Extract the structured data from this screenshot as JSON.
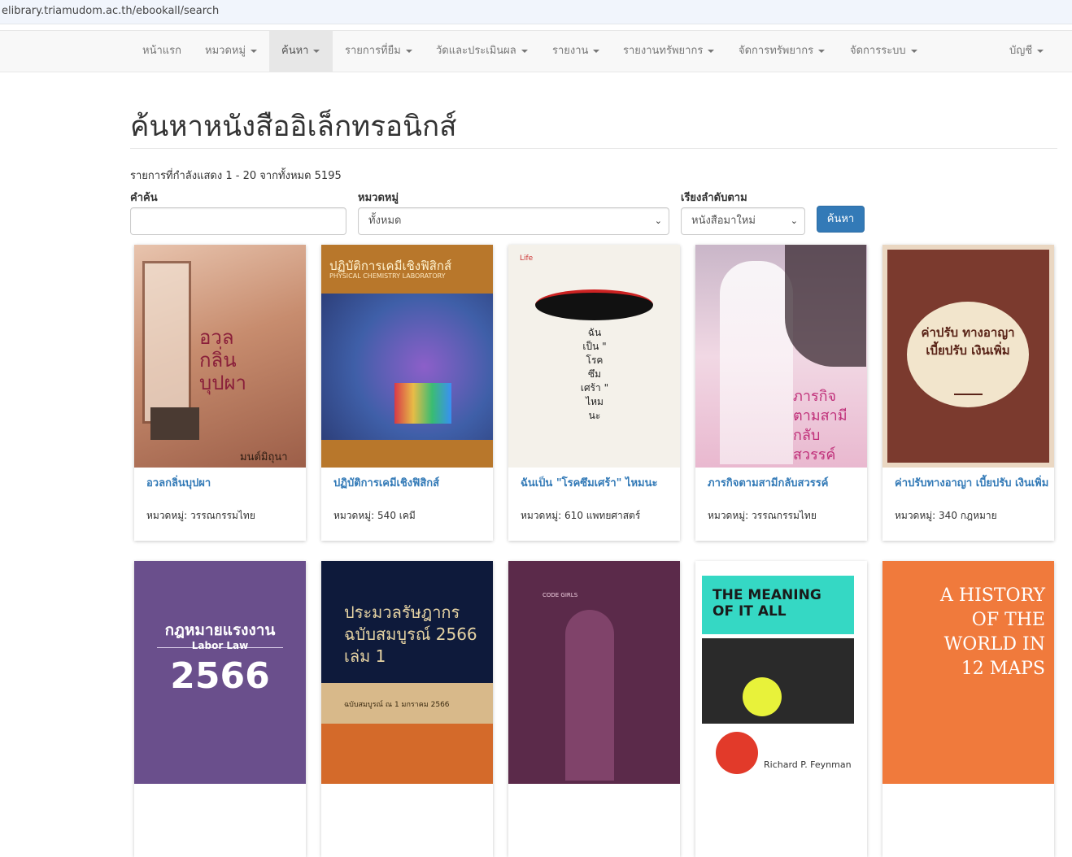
{
  "browser": {
    "url": "elibrary.triamudom.ac.th/ebookall/search"
  },
  "nav": {
    "items": [
      {
        "label": "หน้าแรก"
      },
      {
        "label": "หมวดหมู่"
      },
      {
        "label": "ค้นหา"
      },
      {
        "label": "รายการที่ยืม"
      },
      {
        "label": "วัดและประเมินผล"
      },
      {
        "label": "รายงาน"
      },
      {
        "label": "รายงานทรัพยากร"
      },
      {
        "label": "จัดการทรัพยากร"
      },
      {
        "label": "จัดการระบบ"
      }
    ],
    "account": "บัญชี"
  },
  "page": {
    "title": "ค้นหาหนังสืออิเล็กทรอนิกส์",
    "showing": "รายการที่กำลังแสดง 1 - 20 จากทั้งหมด 5195"
  },
  "filters": {
    "keyword_label": "คำค้น",
    "keyword_value": "",
    "category_label": "หมวดหมู่",
    "category_value": "ทั้งหมด",
    "sort_label": "เรียงลำดับตาม",
    "sort_value": "หนังสือมาใหม่",
    "search_button": "ค้นหา"
  },
  "category_prefix": "หมวดหมู่:",
  "books": [
    {
      "title": "อวลกลิ่นบุปผา",
      "category": "วรรณกรรมไทย",
      "cover": {
        "bg": "#c79a82",
        "text": "อวล กลิ่น บุปผา",
        "sub": "มนต์มิถุนา",
        "fg": "#8a1f3a"
      }
    },
    {
      "title": "ปฏิบัติการเคมีเชิงฟิสิกส์",
      "category": "540 เคมี",
      "cover": {
        "bg": "#b8772b",
        "text": "ปฏิบัติการเคมีเชิงฟิสิกส์",
        "sub": "PHYSICAL CHEMISTRY LABORATORY",
        "fg": "#fff3d0"
      }
    },
    {
      "title": "ฉันเป็น \"โรคซึมเศร้า\" ไหมนะ",
      "category": "610 แพทยศาสตร์",
      "cover": {
        "bg": "#f4f1ea",
        "text": "ฉัน เป็น \" โรค ซึม เศร้า \" ไหม นะ",
        "sub": "Life",
        "fg": "#222"
      }
    },
    {
      "title": "ภารกิจตามสามีกลับสวรรค์",
      "category": "วรรณกรรมไทย",
      "cover": {
        "bg": "#e9c9d8",
        "text": "ภารกิจ ตามสามี กลับสวรรค์",
        "sub": "",
        "fg": "#c0307a"
      }
    },
    {
      "title": "ค่าปรับทางอาญา เบี้ยปรับ เงินเพิ่ม",
      "category": "340 กฎหมาย",
      "cover": {
        "bg": "#7b3a2e",
        "text": "ค่าปรับ ทางอาญา เบี้ยปรับ เงินเพิ่ม",
        "sub": "",
        "fg": "#5a2418"
      }
    },
    {
      "title": "",
      "category": "",
      "cover": {
        "bg": "#6a4f8c",
        "text": "กฎหมายแรงงาน",
        "sub": "Labor Law",
        "year": "2566",
        "fg": "#ffffff"
      }
    },
    {
      "title": "",
      "category": "",
      "cover": {
        "bg": "#0e1a3b",
        "text": "ประมวลรัษฎากร ฉบับสมบูรณ์ 2566 เล่ม 1",
        "sub": "ฉบับสมบูรณ์ ณ 1 มกราคม 2566",
        "fg": "#e6d3a3"
      }
    },
    {
      "title": "",
      "category": "",
      "cover": {
        "bg": "#5b2a4a",
        "text": "CODE GIRLS",
        "sub": "",
        "fg": "#f0d0e0"
      }
    },
    {
      "title": "",
      "category": "",
      "cover": {
        "bg": "#ffffff",
        "text": "THE MEANING OF IT ALL",
        "sub": "Richard P. Feynman",
        "fg": "#1a1a1a"
      }
    },
    {
      "title": "",
      "category": "",
      "cover": {
        "bg": "#f07a3c",
        "text": "A HISTORY OF THE WORLD IN 12 MAPS",
        "sub": "",
        "fg": "#ffffff"
      }
    }
  ]
}
